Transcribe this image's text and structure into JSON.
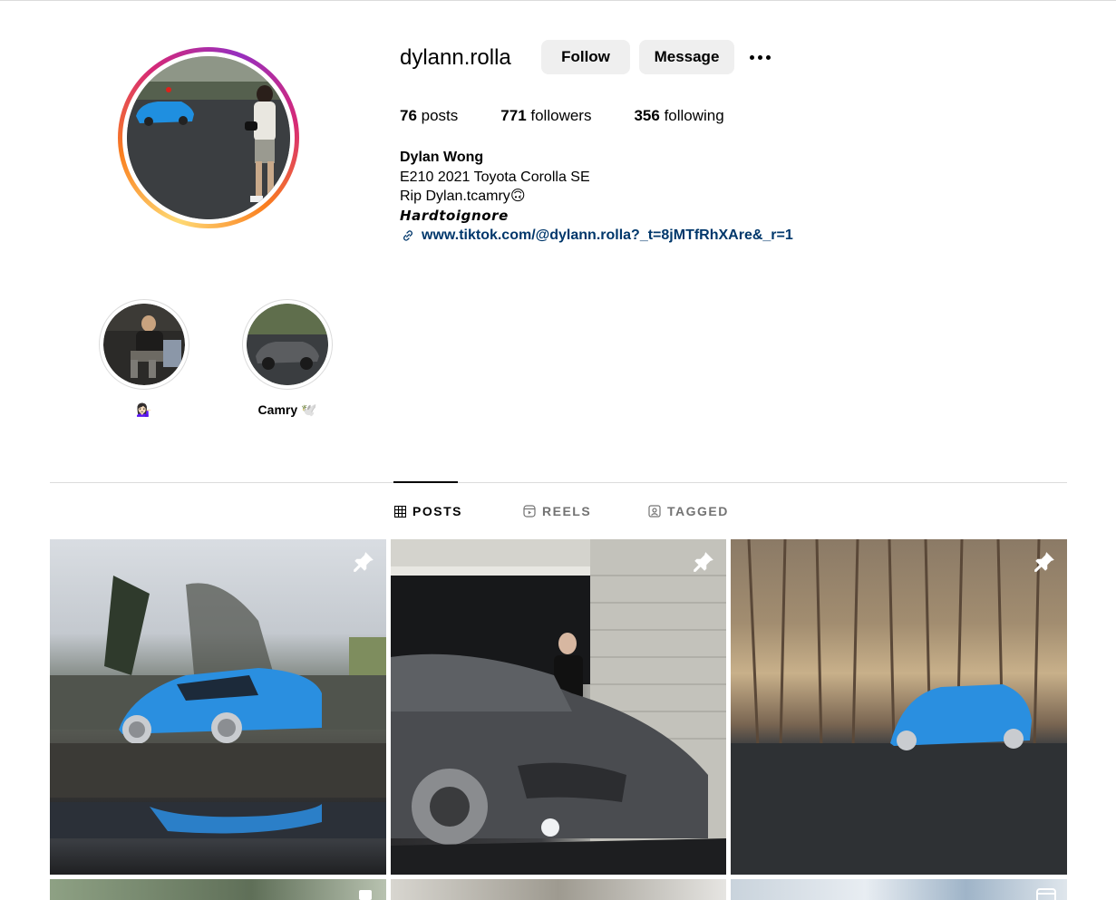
{
  "profile": {
    "username": "dylann.rolla",
    "follow_label": "Follow",
    "message_label": "Message",
    "stats": [
      {
        "count": "76",
        "label": " posts"
      },
      {
        "count": "771",
        "label": " followers"
      },
      {
        "count": "356",
        "label": " following"
      }
    ],
    "bio": {
      "name": "Dylan Wong",
      "line1": "E210 2021 Toyota Corolla SE",
      "line2": "Rip Dylan.tcamry",
      "line2_emoji": "🙃",
      "line3": "Hardtoignore",
      "link": "www.tiktok.com/@dylann.rolla?_t=8jMTfRhXAre&_r=1"
    }
  },
  "highlights": [
    {
      "label": "💁🏻‍♀️"
    },
    {
      "label": "Camry 🕊️"
    }
  ],
  "tabs": [
    {
      "label": "POSTS",
      "icon": "grid-icon",
      "active": true
    },
    {
      "label": "REELS",
      "icon": "reels-icon",
      "active": false
    },
    {
      "label": "TAGGED",
      "icon": "tagged-icon",
      "active": false
    }
  ],
  "posts": [
    {
      "description": "blue Corolla hatchback with puddle reflection",
      "pinned": true
    },
    {
      "description": "grey Camry in garage with person",
      "pinned": true
    },
    {
      "description": "blue Corolla in forest parking lot",
      "pinned": true
    },
    {
      "pinned": false
    },
    {
      "pinned": false
    },
    {
      "pinned": false,
      "is_reel": true
    }
  ],
  "colors": {
    "button_bg": "#efefef",
    "link": "#00376b",
    "divider": "#dbdbdb",
    "muted_tab": "#737373"
  }
}
